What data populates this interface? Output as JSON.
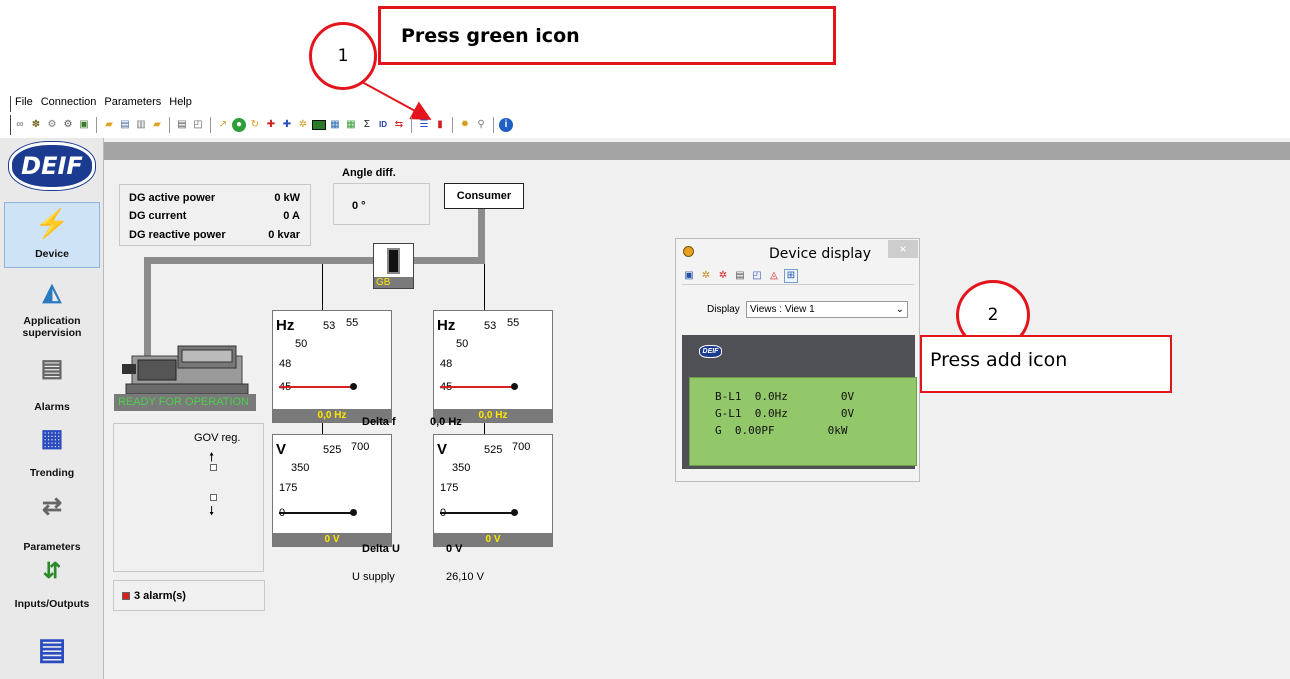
{
  "annotations": {
    "step1_number": "1",
    "step1_text": "Press green icon",
    "step2_number": "2",
    "step2_text": "Press add icon",
    "color": "#e3141b"
  },
  "menu": [
    "File",
    "Connection",
    "Parameters",
    "Help"
  ],
  "nav": {
    "logo": "DEIF",
    "items": [
      {
        "label": "Device",
        "icon": "device-icon"
      },
      {
        "label": "Application supervision",
        "icon": "application-supervision-icon"
      },
      {
        "label": "Alarms",
        "icon": "alarms-icon"
      },
      {
        "label": "Trending",
        "icon": "trending-icon"
      },
      {
        "label": "Parameters",
        "icon": "parameters-icon"
      },
      {
        "label": "Inputs/Outputs",
        "icon": "inputs-outputs-icon"
      }
    ]
  },
  "measurements": {
    "dg_active_power_label": "DG active power",
    "dg_active_power_value": "0 kW",
    "dg_current_label": "DG current",
    "dg_current_value": "0 A",
    "dg_reactive_power_label": "DG reactive power",
    "dg_reactive_power_value": "0 kvar",
    "angle_diff_label": "Angle diff.",
    "angle_diff_value": "0 °",
    "consumer_label": "Consumer",
    "gb_label": "GB",
    "status_text": "READY FOR OPERATION",
    "gov_reg_label": "GOV reg.",
    "alarm_text": "3 alarm(s)",
    "delta_f_label": "Delta f",
    "delta_f_value": "0,0 Hz",
    "delta_u_label": "Delta U",
    "delta_u_value": "0 V",
    "u_supply_label": "U supply",
    "u_supply_value": "26,10 V"
  },
  "meters": {
    "hz_unit": "Hz",
    "hz_ticks": [
      "53",
      "55",
      "50",
      "48",
      "45"
    ],
    "hz_value": "0,0 Hz",
    "v_unit": "V",
    "v_ticks": [
      "525",
      "700",
      "350",
      "175",
      "0"
    ],
    "v_value": "0 V"
  },
  "device_display": {
    "title": "Device display",
    "close": "×",
    "display_label": "Display",
    "display_value": "Views : View 1",
    "lcd_logo": "DEIF",
    "lcd_rows": [
      "B-L1  0.0Hz        0V",
      "G-L1  0.0Hz        0V",
      "G  0.00PF        0kW"
    ]
  }
}
